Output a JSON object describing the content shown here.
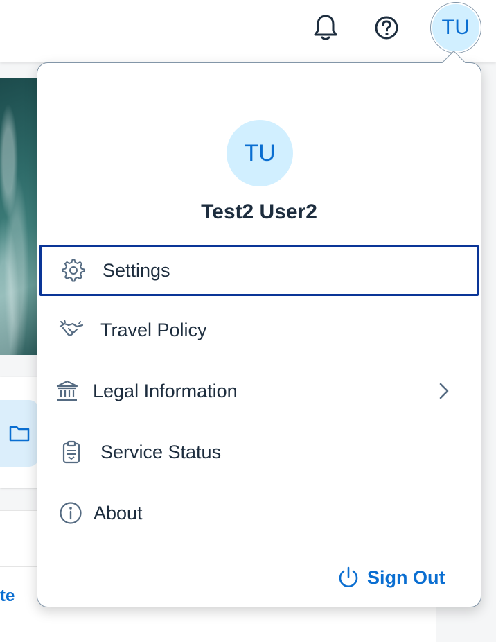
{
  "shellbar": {
    "avatar_initials": "TU",
    "icons": [
      "bell-icon",
      "help-icon"
    ]
  },
  "background": {
    "partial_link_text": "te"
  },
  "user_menu": {
    "avatar_initials": "TU",
    "user_name": "Test2 User2",
    "items": [
      {
        "label": "Settings",
        "icon": "gear-icon",
        "focused": true
      },
      {
        "label": "Travel Policy",
        "icon": "handshake-icon"
      },
      {
        "label": "Legal Information",
        "icon": "bank-icon",
        "has_submenu": true
      },
      {
        "label": "Service Status",
        "icon": "clipboard-icon"
      },
      {
        "label": "About",
        "icon": "info-icon"
      }
    ],
    "sign_out_label": "Sign Out"
  },
  "colors": {
    "accent": "#0a6ed1",
    "focus_border": "#0a3597",
    "avatar_bg": "#d1efff",
    "text": "#1d2d3e",
    "icon": "#556b82"
  }
}
